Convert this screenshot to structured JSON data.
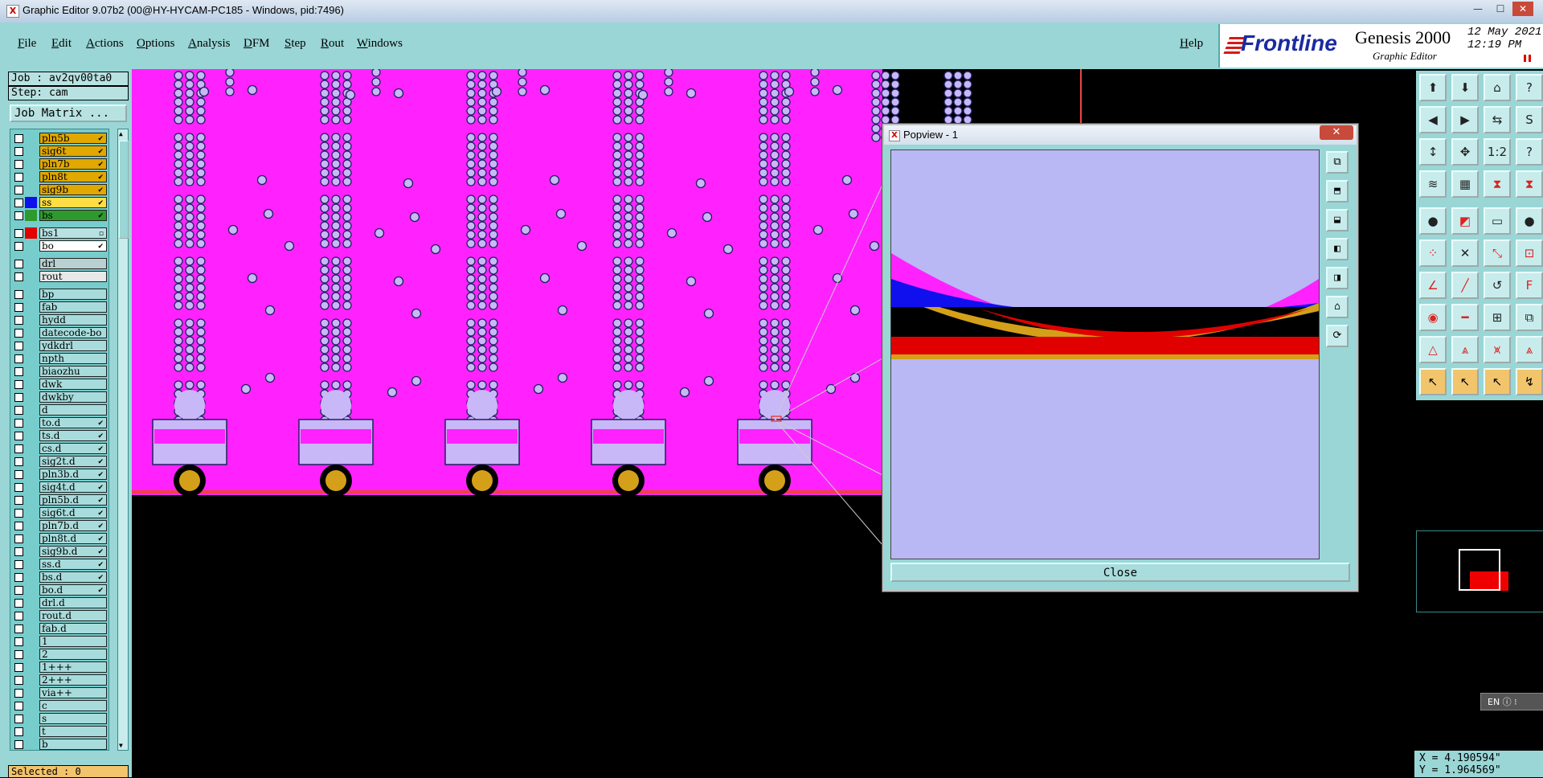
{
  "window": {
    "title": "Graphic Editor 9.07b2 (00@HY-HYCAM-PC185 - Windows, pid:7496)",
    "controls": [
      "minimize",
      "maximize",
      "close"
    ]
  },
  "menu": {
    "items": [
      "File",
      "Edit",
      "Actions",
      "Options",
      "Analysis",
      "DFM",
      "Step",
      "Rout",
      "Windows"
    ],
    "help": "Help"
  },
  "brand": {
    "logo": "Frontline",
    "product": "Genesis 2000",
    "subtitle": "Graphic Editor",
    "date": "12 May 2021",
    "time": "12:19 PM"
  },
  "job": {
    "job_label": "Job : av2qv00ta0",
    "step_label": "Step: cam",
    "matrix_button": "Job Matrix ..."
  },
  "layers": [
    {
      "name": "pln5b",
      "color": "#e0a800",
      "mark": "✔"
    },
    {
      "name": "sig6t",
      "color": "#e0a800",
      "mark": "✔"
    },
    {
      "name": "pln7b",
      "color": "#e0a800",
      "mark": "✔"
    },
    {
      "name": "pln8t",
      "color": "#e0a800",
      "mark": "✔"
    },
    {
      "name": "sig9b",
      "color": "#e0a800",
      "mark": "✔"
    },
    {
      "name": "ss",
      "color": "#ffdd44",
      "swatch": "#1010ee",
      "mark": "✔"
    },
    {
      "name": "bs",
      "color": "#2e9a2e",
      "swatch": "#2e9a2e",
      "mark": "✔"
    },
    {
      "name": "bs1",
      "color": "#b8e2e2",
      "swatch": "#e00000",
      "mark": "▫"
    },
    {
      "name": "bo",
      "color": "#ffffff",
      "mark": "✔"
    },
    {
      "name": "drl",
      "color": "#b8d0d0"
    },
    {
      "name": "rout",
      "color": "#e8e8e8"
    },
    {
      "name": "bp"
    },
    {
      "name": "fab"
    },
    {
      "name": "hydd"
    },
    {
      "name": "datecode-bo"
    },
    {
      "name": "ydkdrl"
    },
    {
      "name": "npth"
    },
    {
      "name": "biaozhu"
    },
    {
      "name": "dwk"
    },
    {
      "name": "dwkby"
    },
    {
      "name": "d"
    },
    {
      "name": "to.d",
      "mark": "✔"
    },
    {
      "name": "ts.d",
      "mark": "✔"
    },
    {
      "name": "cs.d",
      "mark": "✔"
    },
    {
      "name": "sig2t.d",
      "mark": "✔"
    },
    {
      "name": "pln3b.d",
      "mark": "✔"
    },
    {
      "name": "sig4t.d",
      "mark": "✔"
    },
    {
      "name": "pln5b.d",
      "mark": "✔"
    },
    {
      "name": "sig6t.d",
      "mark": "✔"
    },
    {
      "name": "pln7b.d",
      "mark": "✔"
    },
    {
      "name": "pln8t.d",
      "mark": "✔"
    },
    {
      "name": "sig9b.d",
      "mark": "✔"
    },
    {
      "name": "ss.d",
      "mark": "✔"
    },
    {
      "name": "bs.d",
      "mark": "✔"
    },
    {
      "name": "bo.d",
      "mark": "✔"
    },
    {
      "name": "drl.d"
    },
    {
      "name": "rout.d"
    },
    {
      "name": "fab.d"
    },
    {
      "name": "1"
    },
    {
      "name": "2"
    },
    {
      "name": "1+++"
    },
    {
      "name": "2+++"
    },
    {
      "name": "via++"
    },
    {
      "name": "c"
    },
    {
      "name": "s"
    },
    {
      "name": "t"
    },
    {
      "name": "b"
    }
  ],
  "status": {
    "selected": "Selected : 0",
    "x": "X = 4.190594\"",
    "y": "Y = 1.964569\""
  },
  "popview": {
    "title": "Popview - 1",
    "close_button": "Close",
    "close_x": "✕"
  },
  "language": "EN",
  "colors": {
    "panel": "#9ad6d6",
    "board": "#ff22ff",
    "pad": "#c8b8f8",
    "copper": "#d4a01a",
    "popview_bg": "#bab7f5"
  }
}
